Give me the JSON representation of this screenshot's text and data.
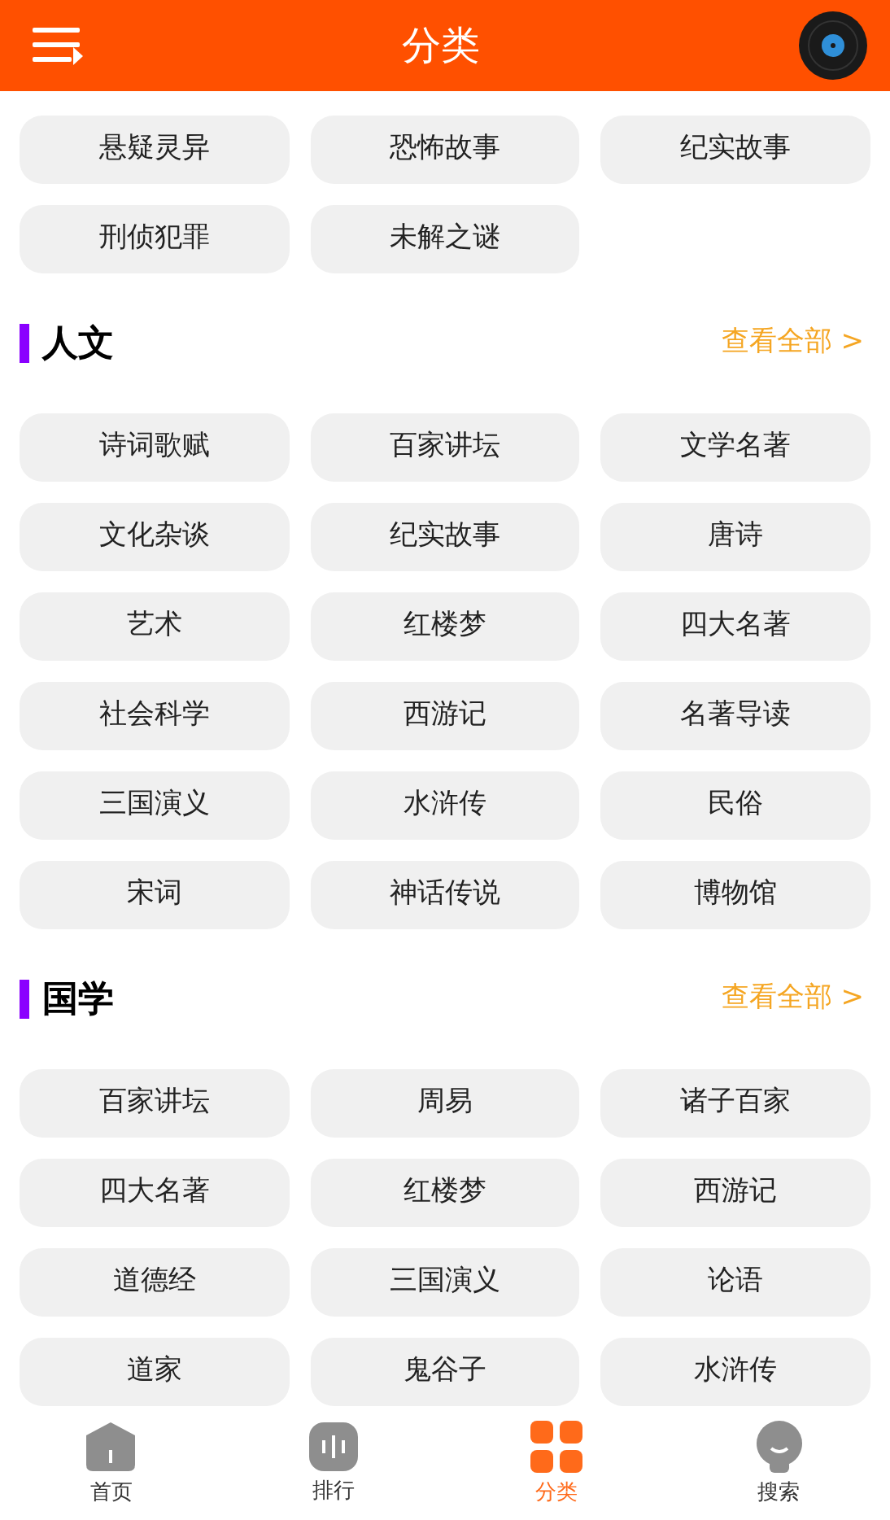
{
  "header": {
    "title": "分类"
  },
  "sections": [
    {
      "items": [
        "悬疑灵异",
        "恐怖故事",
        "纪实故事",
        "刑侦犯罪",
        "未解之谜"
      ]
    },
    {
      "title": "人文",
      "more": "查看全部 >",
      "items": [
        "诗词歌赋",
        "百家讲坛",
        "文学名著",
        "文化杂谈",
        "纪实故事",
        "唐诗",
        "艺术",
        "红楼梦",
        "四大名著",
        "社会科学",
        "西游记",
        "名著导读",
        "三国演义",
        "水浒传",
        "民俗",
        "宋词",
        "神话传说",
        "博物馆"
      ]
    },
    {
      "title": "国学",
      "more": "查看全部 >",
      "items": [
        "百家讲坛",
        "周易",
        "诸子百家",
        "四大名著",
        "红楼梦",
        "西游记",
        "道德经",
        "三国演义",
        "论语",
        "道家",
        "鬼谷子",
        "水浒传"
      ]
    }
  ],
  "tab_bar": [
    {
      "kind": "home",
      "label": "首页",
      "selected": false
    },
    {
      "kind": "rank",
      "label": "排行",
      "selected": false
    },
    {
      "kind": "category",
      "label": "分类",
      "selected": true
    },
    {
      "kind": "search",
      "label": "搜索",
      "selected": false
    }
  ]
}
